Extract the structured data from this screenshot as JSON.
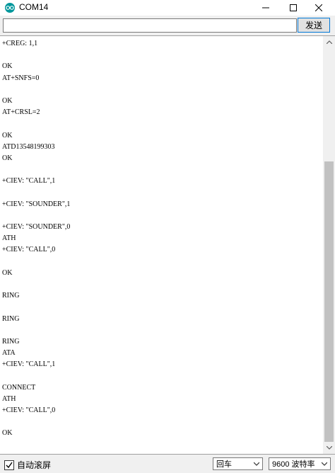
{
  "window": {
    "title": "COM14"
  },
  "send_bar": {
    "input_value": "",
    "send_label": "发送"
  },
  "console": {
    "lines": [
      "+CREG: 1,1",
      "",
      "OK",
      "AT+SNFS=0",
      "",
      "OK",
      "AT+CRSL=2",
      "",
      "OK",
      "ATD13548199303",
      "OK",
      "",
      "+CIEV: \"CALL\",1",
      "",
      "+CIEV: \"SOUNDER\",1",
      "",
      "+CIEV: \"SOUNDER\",0",
      "ATH",
      "+CIEV: \"CALL\",0",
      "",
      "OK",
      "",
      "RING",
      "",
      "RING",
      "",
      "RING",
      "ATA",
      "+CIEV: \"CALL\",1",
      "",
      "CONNECT",
      "ATH",
      "+CIEV: \"CALL\",0",
      "",
      "OK",
      ""
    ]
  },
  "bottom": {
    "autoscroll_label": "自动滚屏",
    "autoscroll_checked": true,
    "line_ending": "回车",
    "baud_rate": "9600 波特率"
  },
  "colors": {
    "arduino_teal": "#00979c",
    "send_border": "#0078d7"
  }
}
